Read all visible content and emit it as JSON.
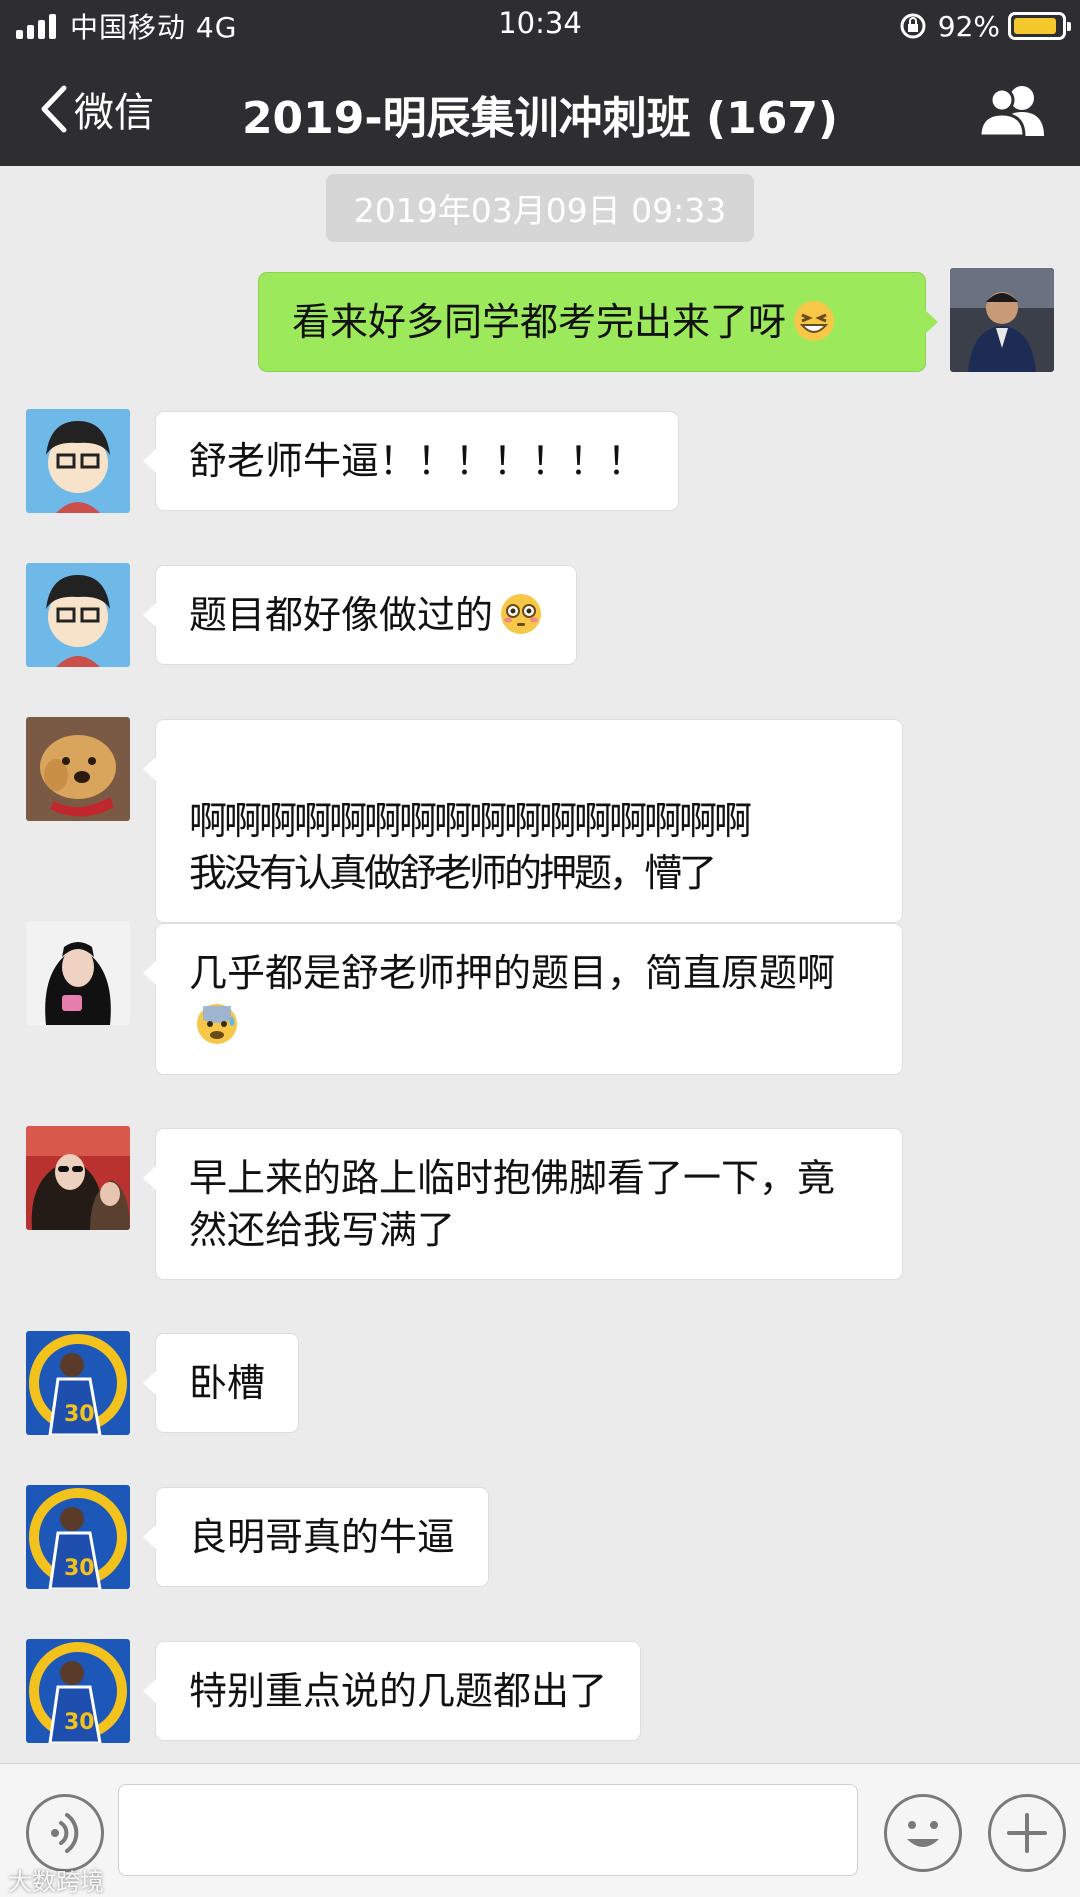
{
  "status_bar": {
    "carrier": "中国移动 4G",
    "time": "10:34",
    "battery_percent": "92%",
    "battery_level": 0.92,
    "battery_color": "#f5c82e"
  },
  "nav": {
    "back_label": "微信",
    "title": "2019-明辰集训冲刺班 (167)"
  },
  "chat": {
    "timestamp": "2019年03月09日 09:33",
    "messages": [
      {
        "side": "right",
        "text": "看来好多同学都考完出来了呀",
        "emoji": "grinning-squint-emoji"
      },
      {
        "side": "left",
        "text": "舒老师牛逼！！！！！！！",
        "emoji": ""
      },
      {
        "side": "left",
        "text": "题目都好像做过的",
        "emoji": "flushed-emoji"
      },
      {
        "side": "left",
        "text": "啊啊啊啊啊啊啊啊啊啊啊啊啊啊啊啊\n我没有认真做舒老师的押题，懵了",
        "emoji": ""
      },
      {
        "side": "left",
        "text": "几乎都是舒老师押的题目，简直原题啊",
        "emoji": "cold-sweat-emoji"
      },
      {
        "side": "left",
        "text": "早上来的路上临时抱佛脚看了一下，竟然还给我写满了",
        "emoji": ""
      },
      {
        "side": "left",
        "text": "卧槽",
        "emoji": ""
      },
      {
        "side": "left",
        "text": "良明哥真的牛逼",
        "emoji": ""
      },
      {
        "side": "left",
        "text": "特别重点说的几题都出了",
        "emoji": ""
      }
    ]
  },
  "input_bar": {
    "value": "",
    "voice_icon": "voice-icon",
    "emoji_icon": "smiley-icon",
    "plus_icon": "plus-icon"
  },
  "watermark": "大数跨境",
  "colors": {
    "header_bg": "#2e2e30",
    "chat_bg": "#ebebeb",
    "self_bubble": "#9de95c"
  }
}
